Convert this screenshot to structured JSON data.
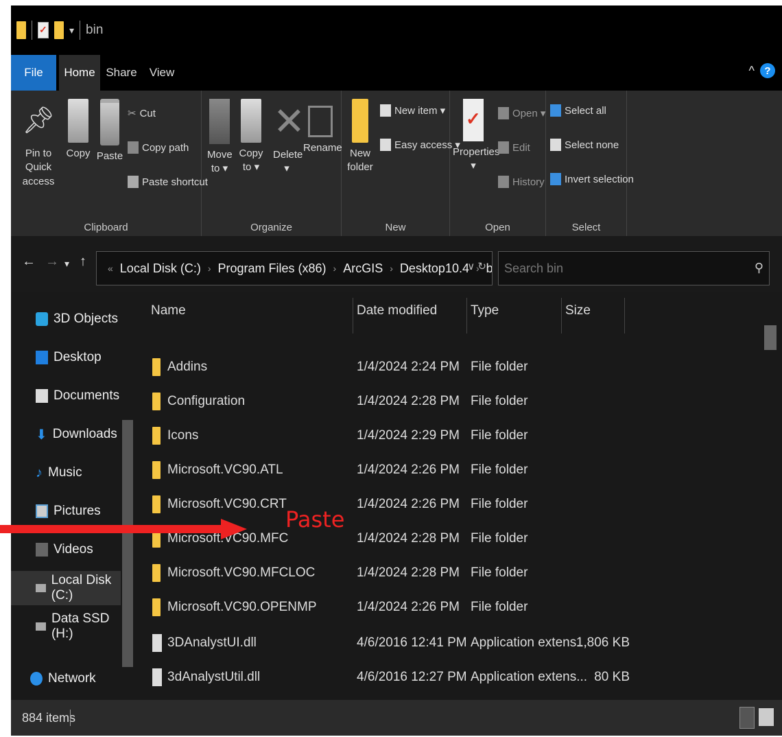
{
  "title_bar": {
    "title": "bin"
  },
  "ribbon_tabs": [
    {
      "label": "File"
    },
    {
      "label": "Home"
    },
    {
      "label": "Share"
    },
    {
      "label": "View"
    }
  ],
  "ribbon": {
    "clipboard": {
      "label": "Clipboard",
      "pin_label_1": "Pin to Quick",
      "pin_label_2": "access",
      "copy": "Copy",
      "paste": "Paste",
      "cut": "Cut",
      "copy_path": "Copy path",
      "paste_shortcut": "Paste shortcut"
    },
    "organize": {
      "label": "Organize",
      "move_1": "Move",
      "move_2": "to ▾",
      "copy_1": "Copy",
      "copy_2": "to ▾",
      "delete": "Delete",
      "delete_drop": "▾",
      "rename": "Rename"
    },
    "new": {
      "label": "New",
      "new_folder_1": "New",
      "new_folder_2": "folder",
      "new_item": "New item ▾",
      "easy_access": "Easy access ▾"
    },
    "open": {
      "label": "Open",
      "properties": "Properties",
      "properties_drop": "▾",
      "open": "Open ▾",
      "edit": "Edit",
      "history": "History"
    },
    "select": {
      "label": "Select",
      "select_all": "Select all",
      "select_none": "Select none",
      "invert_selection": "Invert selection"
    }
  },
  "address_bar": {
    "overflow": "«",
    "breadcrumbs": [
      "Local Disk (C:)",
      "Program Files (x86)",
      "ArcGIS",
      "Desktop10.4",
      "bin"
    ],
    "search_placeholder": "Search bin"
  },
  "nav_pane": [
    {
      "label": "3D Objects",
      "icon": "cube-icon"
    },
    {
      "label": "Desktop",
      "icon": "desktop-icon"
    },
    {
      "label": "Documents",
      "icon": "documents-icon"
    },
    {
      "label": "Downloads",
      "icon": "download-arrow-icon"
    },
    {
      "label": "Music",
      "icon": "music-note-icon"
    },
    {
      "label": "Pictures",
      "icon": "pictures-icon"
    },
    {
      "label": "Videos",
      "icon": "videos-icon"
    },
    {
      "label": "Local Disk (C:)",
      "icon": "drive-icon"
    },
    {
      "label": "Data SSD (H:)",
      "icon": "drive-icon"
    },
    {
      "label": "Network",
      "icon": "network-icon"
    }
  ],
  "columns": {
    "name": "Name",
    "date": "Date modified",
    "type": "Type",
    "size": "Size"
  },
  "files": [
    {
      "name": "Addins",
      "date": "1/4/2024 2:24 PM",
      "type": "File folder",
      "size": "",
      "kind": "folder"
    },
    {
      "name": "Configuration",
      "date": "1/4/2024 2:28 PM",
      "type": "File folder",
      "size": "",
      "kind": "folder"
    },
    {
      "name": "Icons",
      "date": "1/4/2024 2:29 PM",
      "type": "File folder",
      "size": "",
      "kind": "folder"
    },
    {
      "name": "Microsoft.VC90.ATL",
      "date": "1/4/2024 2:26 PM",
      "type": "File folder",
      "size": "",
      "kind": "folder"
    },
    {
      "name": "Microsoft.VC90.CRT",
      "date": "1/4/2024 2:26 PM",
      "type": "File folder",
      "size": "",
      "kind": "folder"
    },
    {
      "name": "Microsoft.VC90.MFC",
      "date": "1/4/2024 2:28 PM",
      "type": "File folder",
      "size": "",
      "kind": "folder"
    },
    {
      "name": "Microsoft.VC90.MFCLOC",
      "date": "1/4/2024 2:28 PM",
      "type": "File folder",
      "size": "",
      "kind": "folder"
    },
    {
      "name": "Microsoft.VC90.OPENMP",
      "date": "1/4/2024 2:26 PM",
      "type": "File folder",
      "size": "",
      "kind": "folder"
    },
    {
      "name": "3DAnalystUI.dll",
      "date": "4/6/2016 12:41 PM",
      "type": "Application extens...",
      "size": "1,806 KB",
      "kind": "dll"
    },
    {
      "name": "3dAnalystUtil.dll",
      "date": "4/6/2016 12:27 PM",
      "type": "Application extens...",
      "size": "80 KB",
      "kind": "dll"
    }
  ],
  "status": {
    "item_count": "884 items"
  },
  "annotation": {
    "label": "Paste",
    "color": "#ee2222"
  },
  "colors": {
    "accent": "#1a6fc4",
    "folder": "#f5c542",
    "background": "#191919"
  }
}
